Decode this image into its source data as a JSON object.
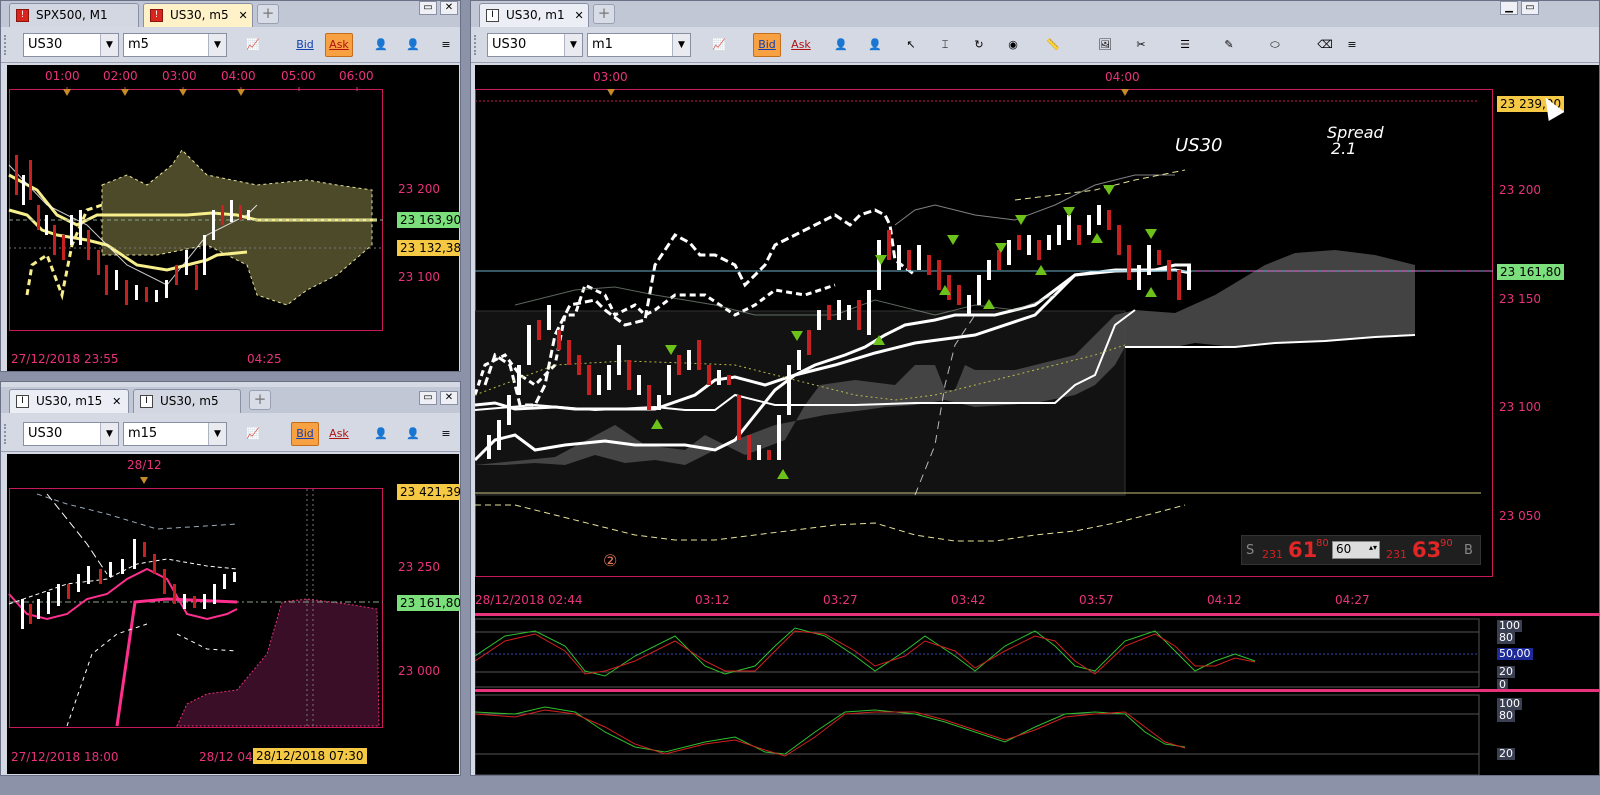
{
  "colors": {
    "accent": "#f7a142",
    "chart_bg": "#000000",
    "axis": "#e8327a",
    "ask_tag": "#f6c945",
    "bid_tag": "#7be07b"
  },
  "window1": {
    "tabs": [
      {
        "label": "SPX500, M1",
        "icon": "alert-icon"
      },
      {
        "label": "US30, m5",
        "icon": "alert-icon"
      }
    ],
    "symbol": "US30",
    "timeframe": "m5",
    "bid": "Bid",
    "ask": "Ask",
    "time_labels": [
      "01:00",
      "02:00",
      "03:00",
      "04:00",
      "05:00",
      "06:00"
    ],
    "price_labels": [
      "23 200",
      "23 100"
    ],
    "price_tags": [
      "23 163,90",
      "23 132,38"
    ],
    "bottom_left": "27/12/2018 23:55",
    "bottom_mid": "04:25"
  },
  "window2": {
    "tabs": [
      {
        "label": "US30, m15",
        "icon": "chart-icon"
      },
      {
        "label": "US30, m5",
        "icon": "chart-icon"
      }
    ],
    "symbol": "US30",
    "timeframe": "m15",
    "bid": "Bid",
    "ask": "Ask",
    "time_labels": [
      "28/12"
    ],
    "price_labels": [
      "23 250",
      "23 000"
    ],
    "price_tags": [
      "23 421,39",
      "23 161,80"
    ],
    "bottom_left": "27/12/2018 18:00",
    "bottom_mid": "28/12 04",
    "cursor_time": "28/12/2018 07:30"
  },
  "window3": {
    "tabs": [
      {
        "label": "US30, m1",
        "icon": "chart-icon"
      }
    ],
    "symbol": "US30",
    "timeframe": "m1",
    "bid": "Bid",
    "ask": "Ask",
    "time_labels": [
      "03:00",
      "04:00"
    ],
    "price_labels": [
      "23 200",
      "23 150",
      "23 100",
      "23 050"
    ],
    "price_tags": [
      "23 239,00",
      "23 161,80"
    ],
    "symbol_text": "US30",
    "spread_title": "Spread",
    "spread_value": "2.1",
    "bottom_times": [
      "28/12/2018 02:44",
      "03:12",
      "03:27",
      "03:42",
      "03:57",
      "04:12",
      "04:27"
    ],
    "sell": {
      "label": "S",
      "small": "231",
      "big": "61",
      "sup": "80"
    },
    "buy": {
      "label": "B",
      "small": "231",
      "big": "63",
      "sup": "90"
    },
    "lot": "60",
    "marker": "②",
    "osc1": {
      "levels": [
        "100",
        "80",
        "50,00",
        "20",
        "0"
      ]
    },
    "osc2": {
      "levels": [
        "100",
        "80",
        "20"
      ]
    }
  }
}
